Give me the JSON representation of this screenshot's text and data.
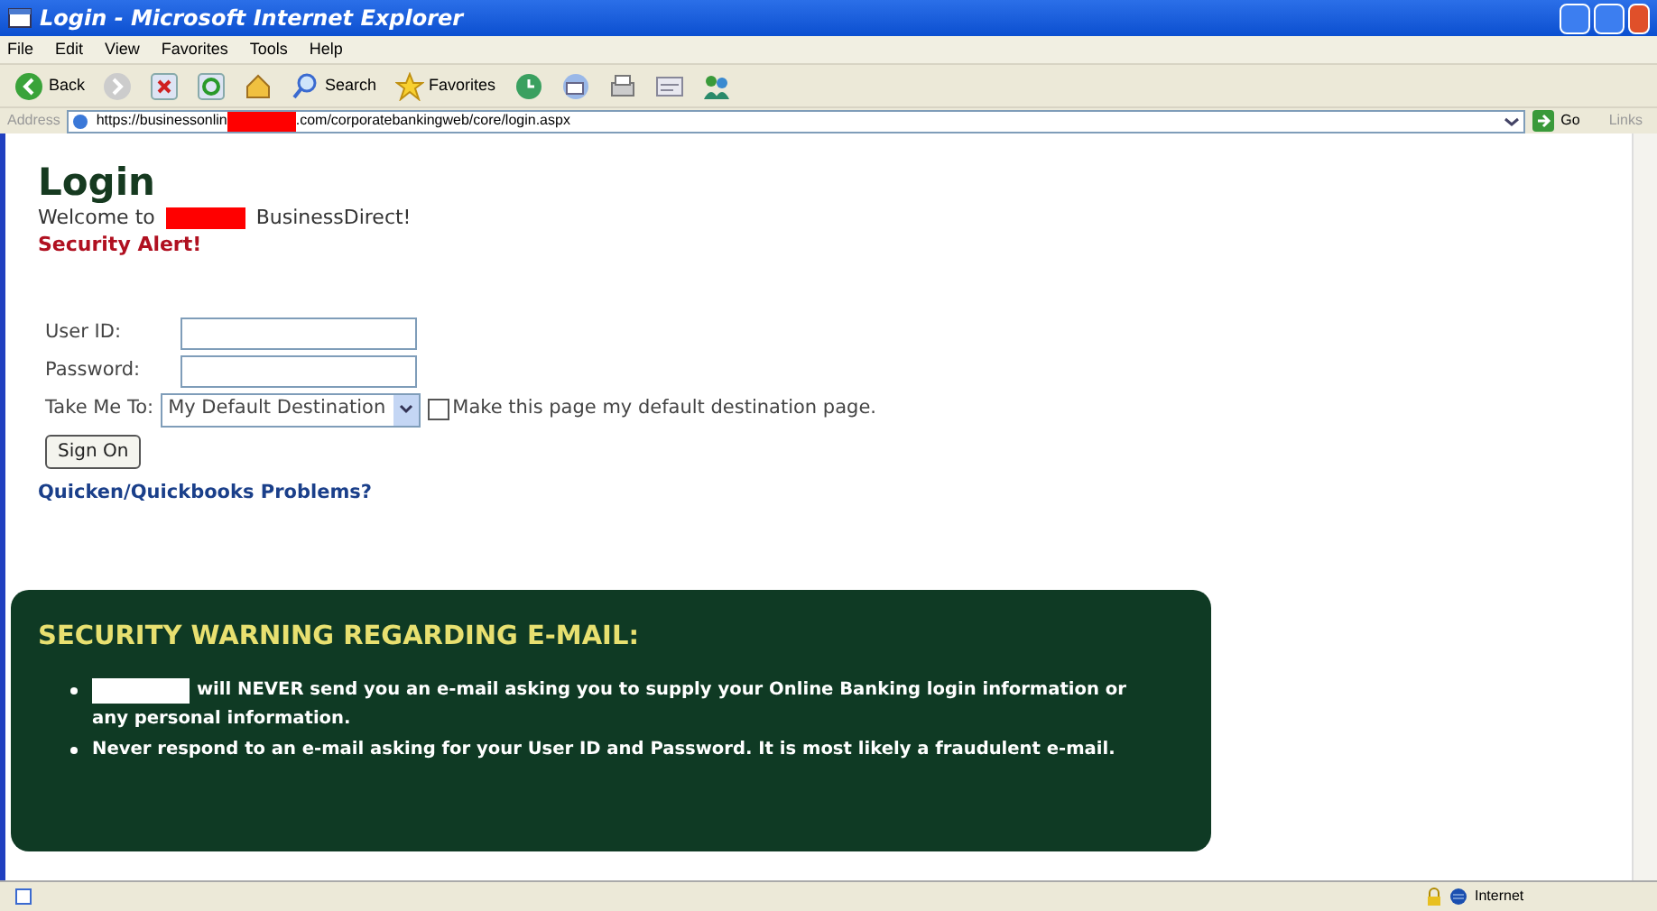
{
  "window": {
    "title": "Login - Microsoft Internet Explorer"
  },
  "menu": [
    "File",
    "Edit",
    "View",
    "Favorites",
    "Tools",
    "Help"
  ],
  "toolbar": [
    {
      "kind": "back",
      "label": "Back"
    },
    {
      "kind": "forward"
    },
    {
      "kind": "stop"
    },
    {
      "kind": "refresh"
    },
    {
      "kind": "home"
    },
    {
      "kind": "search",
      "label": "Search"
    },
    {
      "kind": "favorites",
      "label": "Favorites"
    },
    {
      "kind": "history"
    },
    {
      "kind": "mail"
    },
    {
      "kind": "print"
    },
    {
      "kind": "edit"
    },
    {
      "kind": "messenger"
    }
  ],
  "address": {
    "label": "Address",
    "url_start": "https://businessonlin",
    "url_end": ".com/corporatebankingweb/core/login.aspx",
    "go": "Go",
    "links": "Links"
  },
  "page": {
    "heading": "Login",
    "welcome_start": "Welcome to",
    "welcome_end": "BusinessDirect!",
    "alert": "Security Alert!",
    "fields": [
      {
        "label": "User ID:"
      },
      {
        "label": "Password:"
      }
    ],
    "destination": {
      "label": "Take Me To:",
      "value": "My Default Destination"
    },
    "default_checkbox": {
      "label": "Make this page my default destination page.",
      "checked": false
    },
    "sign_on": "Sign On",
    "help_link": "Quicken/Quickbooks Problems?"
  },
  "warning": {
    "title": "SECURITY WARNING REGARDING E-MAIL:",
    "items": [
      {
        "redacted_start": true,
        "text": "will NEVER send you an e-mail asking you to supply your Online Banking login information or any personal information."
      },
      {
        "redacted_start": false,
        "text": "Never respond to an e-mail asking for your User ID and Password. It is most likely a fraudulent e-mail."
      }
    ]
  },
  "status_bar": {
    "zone": "Internet"
  }
}
